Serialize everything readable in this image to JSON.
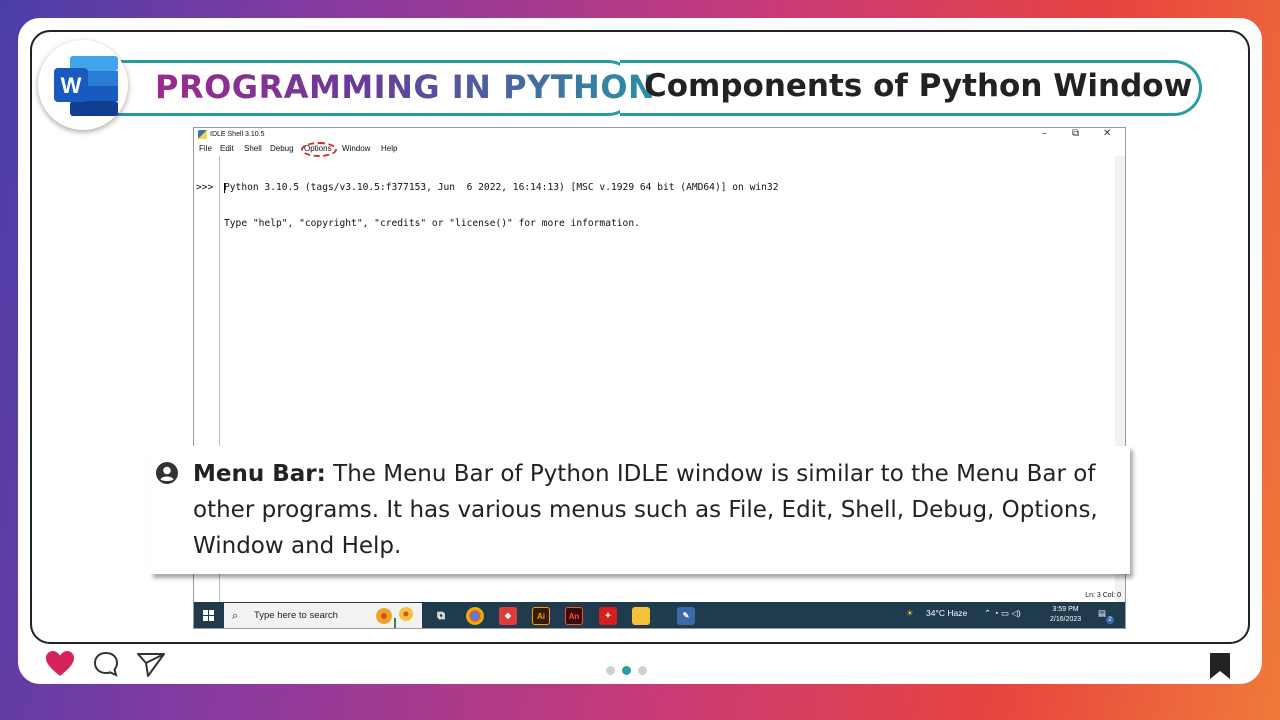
{
  "header": {
    "title": "PROGRAMMING IN PYTHON",
    "subtitle": "Components of Python Window",
    "app_icon_letter": "W"
  },
  "idle": {
    "window_title": "IDLE Shell 3.10.5",
    "controls": {
      "minimize": "–",
      "restore": "⧉",
      "close": "✕"
    },
    "menu": [
      "File",
      "Edit",
      "Shell",
      "Debug",
      "Options",
      "Window",
      "Help"
    ],
    "highlighted_menu": "Options",
    "lines": [
      "Python 3.10.5 (tags/v3.10.5:f377153, Jun  6 2022, 16:14:13) [MSC v.1929 64 bit (AMD64)] on win32",
      "Type \"help\", \"copyright\", \"credits\" or \"license()\" for more information."
    ],
    "prompt": ">>>",
    "status": "Ln: 3   Col: 0"
  },
  "taskbar": {
    "search_placeholder": "Type here to search",
    "apps": [
      "Ai",
      "An"
    ],
    "weather": "34°C  Haze",
    "time": "3:59 PM",
    "date": "2/16/2023",
    "notification_count": "2"
  },
  "caption": {
    "term": "Menu Bar:",
    "text": " The Menu Bar of Python IDLE window is similar to the Menu Bar of other programs. It has various menus such as File, Edit, Shell, Debug, Options, Window and Help."
  },
  "colors": {
    "accent": "#2a9da3",
    "highlight_ring": "#d42a2a",
    "taskbar": "#203a4e",
    "heart": "#d4245a"
  },
  "social": {
    "icons": [
      "heart-icon",
      "comment-icon",
      "send-icon",
      "bookmark-icon"
    ],
    "active_page_dot": 2,
    "page_dots": 3
  }
}
